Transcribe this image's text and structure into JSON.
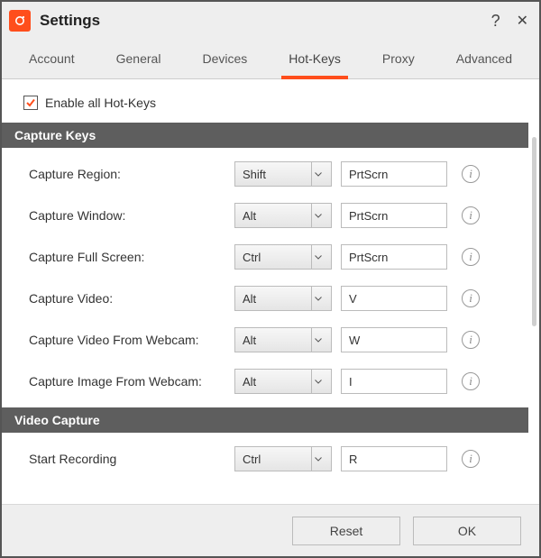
{
  "header": {
    "title": "Settings"
  },
  "tabs": {
    "account": "Account",
    "general": "General",
    "devices": "Devices",
    "hotkeys": "Hot-Keys",
    "proxy": "Proxy",
    "advanced": "Advanced"
  },
  "enable_all": {
    "label": "Enable all Hot-Keys",
    "checked": true
  },
  "sections": {
    "capture_keys": {
      "title": "Capture Keys",
      "rows": {
        "region": {
          "label": "Capture Region:",
          "modifier": "Shift",
          "key": "PrtScrn"
        },
        "window": {
          "label": "Capture Window:",
          "modifier": "Alt",
          "key": "PrtScrn"
        },
        "full": {
          "label": "Capture Full Screen:",
          "modifier": "Ctrl",
          "key": "PrtScrn"
        },
        "video": {
          "label": "Capture Video:",
          "modifier": "Alt",
          "key": "V"
        },
        "vwebcam": {
          "label": "Capture Video From Webcam:",
          "modifier": "Alt",
          "key": "W"
        },
        "iwebcam": {
          "label": "Capture Image From Webcam:",
          "modifier": "Alt",
          "key": "I"
        }
      }
    },
    "video_capture": {
      "title": "Video Capture",
      "rows": {
        "start": {
          "label": "Start Recording",
          "modifier": "Ctrl",
          "key": "R"
        }
      }
    }
  },
  "footer": {
    "reset": "Reset",
    "ok": "OK"
  },
  "info_glyph": "i"
}
